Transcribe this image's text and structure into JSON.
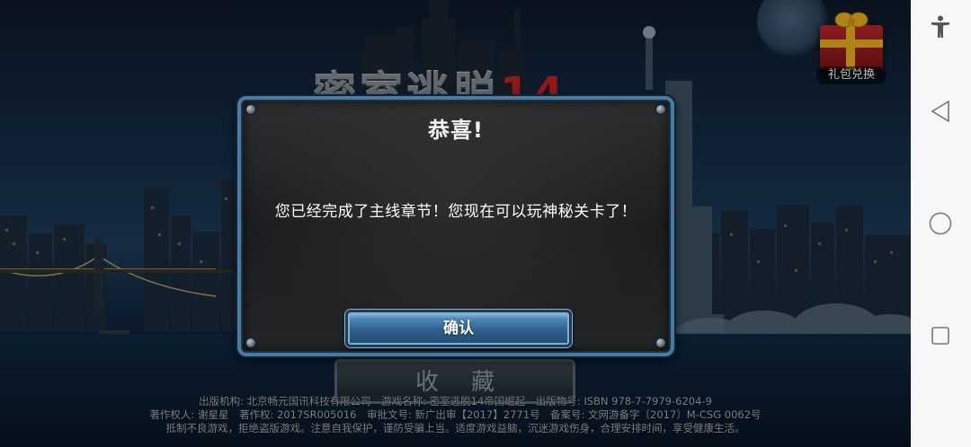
{
  "gift": {
    "label": "礼包兑换",
    "icon": "gift-box-icon",
    "colors": {
      "box": "#c1272d",
      "ribbon": "#f0b81e"
    }
  },
  "logo": {
    "text": "密室逃脱",
    "number": "14"
  },
  "dialog": {
    "title": "恭喜!",
    "message": "您已经完成了主线章节！您现在可以玩神秘关卡了！",
    "confirm_label": "确认"
  },
  "collect_label": "收藏",
  "footer": {
    "line1": "出版机构: 北京畅元国讯科技有限公司　游戏名称: 密室逃脱14帝国崛起　出版物号: ISBN 978-7-7979-6204-9",
    "line2": "著作权人: 谢星星　著作权: 2017SR005016　审批文号: 新广出审【2017】2771号　备案号: 文网游备字〔2017〕M-CSG 0062号",
    "line3": "抵制不良游戏，拒绝盗版游戏。注意自我保护，谨防受骗上当。适度游戏益脑，沉迷游戏伤身，合理安排时间，享受健康生活。"
  },
  "navbar": {
    "accessibility": "accessibility-icon",
    "back": "back-triangle-icon",
    "home": "home-circle-icon",
    "recents": "recents-square-icon"
  },
  "theme": {
    "dialog_border": "#4c7aa0",
    "confirm_button": "#2f5f8c"
  }
}
